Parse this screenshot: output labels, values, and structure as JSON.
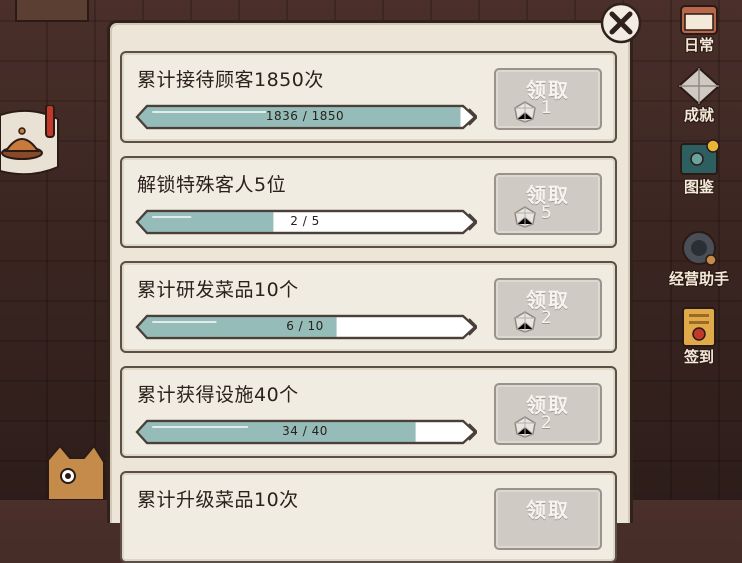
{
  "side_menu": [
    {
      "label": "日常",
      "icon": "calendar-icon"
    },
    {
      "label": "成就",
      "icon": "diamond-icon"
    },
    {
      "label": "图鉴",
      "icon": "book-icon"
    },
    {
      "label": "经营助手",
      "icon": "helper-pet-icon"
    },
    {
      "label": "签到",
      "icon": "checkin-scroll-icon"
    }
  ],
  "close_icon": "close-icon",
  "achievements": [
    {
      "title": "累计接待顾客1850次",
      "progress_text": "1836 / 1850",
      "progress": 0.992,
      "claim_label": "领取",
      "reward": "1"
    },
    {
      "title": "解锁特殊客人5位",
      "progress_text": "2 / 5",
      "progress": 0.4,
      "claim_label": "领取",
      "reward": "5"
    },
    {
      "title": "累计研发菜品10个",
      "progress_text": "6 / 10",
      "progress": 0.6,
      "claim_label": "领取",
      "reward": "2"
    },
    {
      "title": "累计获得设施40个",
      "progress_text": "34 / 40",
      "progress": 0.85,
      "claim_label": "领取",
      "reward": "2"
    },
    {
      "title": "累计升级菜品10次",
      "claim_label": "领取"
    }
  ],
  "colors": {
    "bar_fill": "#95bcb8",
    "bar_empty": "#ffffff",
    "panel": "#ede6d8",
    "claim_disabled": "#cfcac4"
  }
}
